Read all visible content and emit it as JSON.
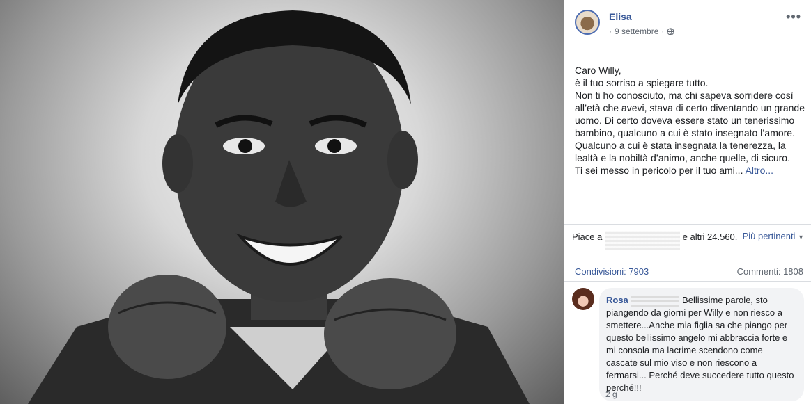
{
  "post": {
    "author": "Elisa",
    "date": "9 settembre",
    "separator": "·",
    "more_label": "•••",
    "text": "Caro Willy,\nè il tuo sorriso a spiegare tutto.\nNon ti ho conosciuto, ma chi sapeva sorridere così all’età che avevi, stava di certo diventando un grande uomo. Di certo doveva essere stato un tenerissimo bambino, qualcuno a cui è stato insegnato l’amore. Qualcuno a cui è stata insegnata la tenerezza, la lealtà e la nobiltà d’animo, anche quelle, di sicuro.\nTi sei messo in pericolo per il tuo ami...",
    "more_text": "Altro..."
  },
  "reactions": {
    "likes_prefix": "Piace a",
    "likes_suffix": "e altri 24.560.",
    "sort_label": "Più pertinenti",
    "shares": "Condivisioni: 7903",
    "comments": "Commenti: 1808"
  },
  "comment": {
    "name": "Rosa",
    "text": "Bellissime parole, sto piangendo da giorni per Willy e non riesco a smettere...Anche mia figlia sa che piango per questo bellissimo angelo mi abbraccia forte e mi consola ma lacrime scendono come cascate sul mio viso e non riescono a fermarsi... Perché deve succedere tutto questo perché!!!",
    "age": "2 g"
  },
  "colors": {
    "link": "#385898",
    "meta": "#606770",
    "bubble": "#f2f3f5"
  }
}
